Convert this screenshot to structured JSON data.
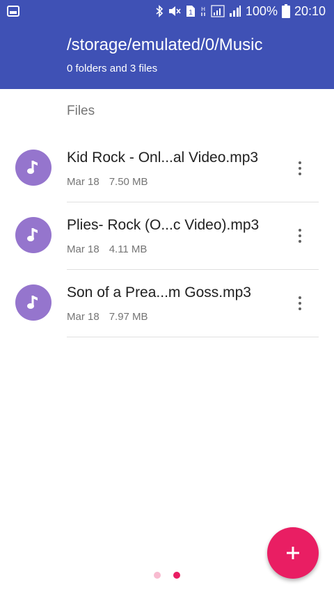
{
  "status_bar": {
    "battery_percent": "100%",
    "time": "20:10",
    "icons": [
      "gallery-icon",
      "bluetooth-icon",
      "mute-icon",
      "sim-icon",
      "network-h-icon",
      "signal-icon",
      "signal-icon",
      "battery-icon"
    ]
  },
  "header": {
    "path": "/storage/emulated/0/Music",
    "subtitle": "0 folders and 3 files"
  },
  "section_label": "Files",
  "files": [
    {
      "name": "Kid Rock - Onl...al Video.mp3",
      "date": "Mar 18",
      "size": "7.50 MB",
      "icon": "music-note-icon"
    },
    {
      "name": "Plies- Rock (O...c Video).mp3",
      "date": "Mar 18",
      "size": "4.11 MB",
      "icon": "music-note-icon"
    },
    {
      "name": "Son of a Prea...m Goss.mp3",
      "date": "Mar 18",
      "size": "7.97 MB",
      "icon": "music-note-icon"
    }
  ],
  "fab": {
    "icon": "plus-icon"
  },
  "pager": {
    "pages": 2,
    "active_index": 1
  },
  "colors": {
    "primary": "#3f51b5",
    "accent": "#e91e63",
    "avatar": "#9575cd"
  }
}
